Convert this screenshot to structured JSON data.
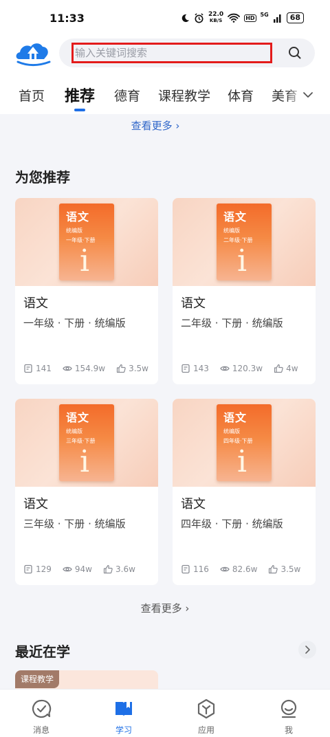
{
  "status_bar": {
    "time": "11:33",
    "net_speed_value": "22.0",
    "net_speed_unit": "KB/S",
    "hd": "HD",
    "signal": "5G",
    "battery": "68"
  },
  "search": {
    "placeholder": "输入关键词搜索"
  },
  "tabs": [
    {
      "label": "首页"
    },
    {
      "label": "推荐"
    },
    {
      "label": "德育"
    },
    {
      "label": "课程教学"
    },
    {
      "label": "体育"
    },
    {
      "label": "美育"
    }
  ],
  "content": {
    "top_more": "查看更多 ›",
    "recommend_title": "为您推荐",
    "bottom_more": "查看更多 ›",
    "recent_title": "最近在学",
    "recent_badge": "课程教学"
  },
  "cards": [
    {
      "cover_title": "语文",
      "cover_edition": "统编版",
      "cover_grade": "一年级·下册",
      "name": "语文",
      "subtitle": "一年级 · 下册 · 统编版",
      "lessons": "141",
      "views": "154.9w",
      "likes": "3.5w"
    },
    {
      "cover_title": "语文",
      "cover_edition": "统编版",
      "cover_grade": "二年级·下册",
      "name": "语文",
      "subtitle": "二年级 · 下册 · 统编版",
      "lessons": "143",
      "views": "120.3w",
      "likes": "4w"
    },
    {
      "cover_title": "语文",
      "cover_edition": "统编版",
      "cover_grade": "三年级·下册",
      "name": "语文",
      "subtitle": "三年级 · 下册 · 统编版",
      "lessons": "129",
      "views": "94w",
      "likes": "3.6w"
    },
    {
      "cover_title": "语文",
      "cover_edition": "统编版",
      "cover_grade": "四年级·下册",
      "name": "语文",
      "subtitle": "四年级 · 下册 · 统编版",
      "lessons": "116",
      "views": "82.6w",
      "likes": "3.5w"
    }
  ],
  "tabbar": [
    {
      "label": "消息",
      "icon": "message-icon"
    },
    {
      "label": "学习",
      "icon": "study-book-icon"
    },
    {
      "label": "应用",
      "icon": "apps-icon"
    },
    {
      "label": "我",
      "icon": "profile-icon"
    }
  ],
  "colors": {
    "accent": "#1e6fe6",
    "link": "#2f66c9",
    "highlight_box": "#e31b1b",
    "book_orange": "#f36b2a"
  }
}
